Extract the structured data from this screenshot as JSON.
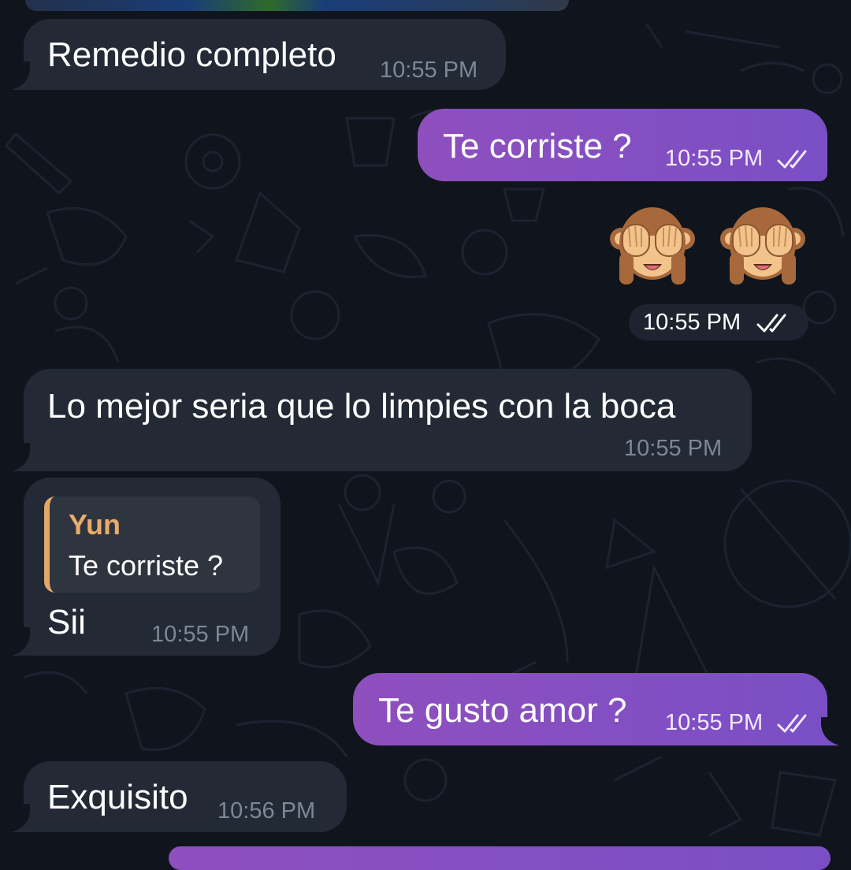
{
  "messages": [
    {
      "direction": "incoming",
      "text": "Remedio completo",
      "time": "10:55 PM"
    },
    {
      "direction": "outgoing",
      "text": "Te corriste ?",
      "time": "10:55 PM",
      "status": "read"
    },
    {
      "direction": "outgoing",
      "emoji": "see-no-evil-monkey x2",
      "time": "10:55 PM",
      "status": "read"
    },
    {
      "direction": "incoming",
      "text": "Lo mejor seria que lo limpies con la boca",
      "time": "10:55 PM"
    },
    {
      "direction": "incoming",
      "reply_to": {
        "name": "Yun",
        "text": "Te corriste ?"
      },
      "text": "Sii",
      "time": "10:55 PM"
    },
    {
      "direction": "outgoing",
      "text": "Te gusto amor ?",
      "time": "10:55 PM",
      "status": "read"
    },
    {
      "direction": "incoming",
      "text": "Exquisito",
      "time": "10:56 PM"
    }
  ],
  "colors": {
    "background": "#10151d",
    "incoming_bubble": "#232a36",
    "outgoing_bubble_start": "#8f4fbe",
    "outgoing_bubble_end": "#7a4fc6",
    "reply_accent": "#e8ac6c",
    "incoming_time": "#7d8795"
  },
  "icons": {
    "read_status": "double-check-icon",
    "emoji": "see-no-evil-monkey"
  }
}
